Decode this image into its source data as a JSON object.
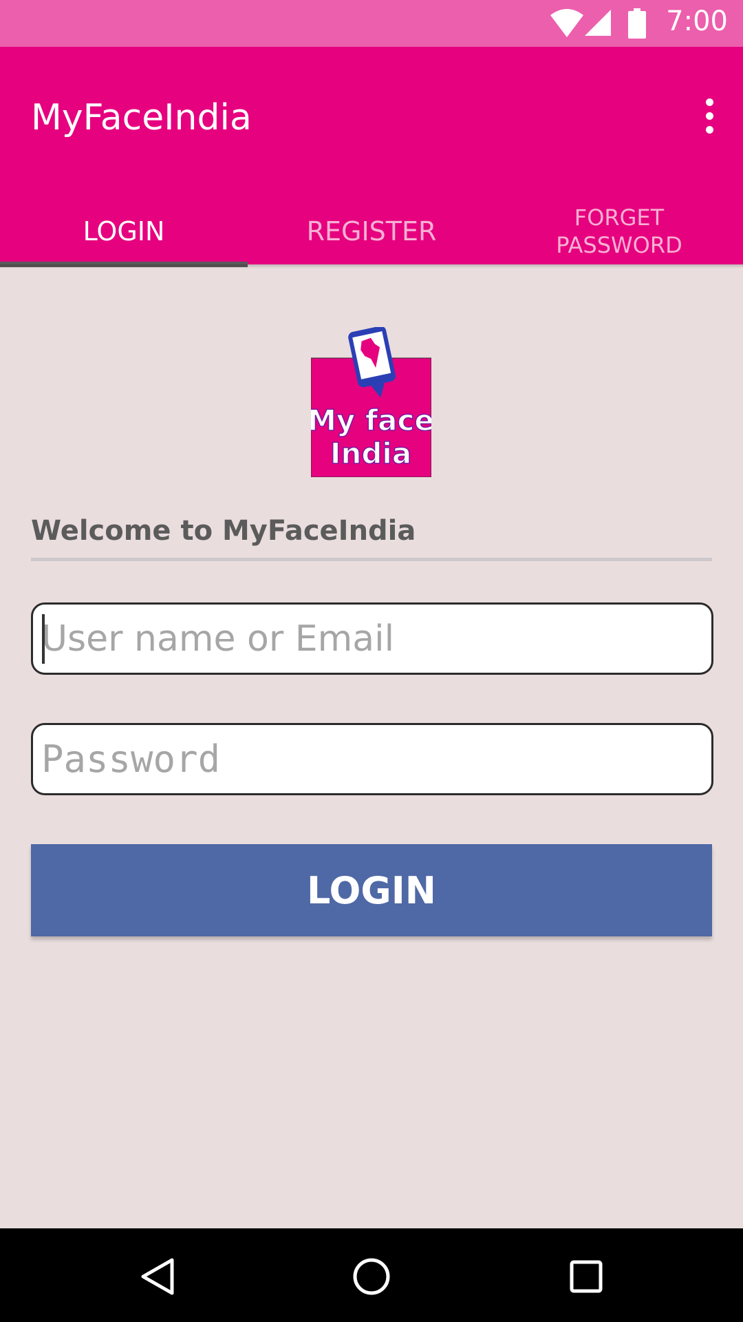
{
  "status_bar": {
    "time": "7:00",
    "icons": [
      "wifi-icon",
      "signal-icon",
      "battery-icon"
    ],
    "color": "#ec5fad"
  },
  "app_bar": {
    "title": "MyFaceIndia",
    "menu_icon": "more-vert-icon",
    "color": "#e6017f"
  },
  "tabs": [
    {
      "label": "LOGIN",
      "active": true
    },
    {
      "label": "REGISTER",
      "active": false
    },
    {
      "label_line1": "FORGET",
      "label_line2": "PASSWORD",
      "active": false
    }
  ],
  "logo": {
    "line1": "My face",
    "line2": "India"
  },
  "form": {
    "welcome": "Welcome to MyFaceIndia",
    "username_placeholder": "User name or Email",
    "username_value": "",
    "password_placeholder": "Password",
    "password_value": "",
    "login_label": "LOGIN",
    "button_color": "#4f68a6"
  },
  "nav_bar": {
    "icons": [
      "back-icon",
      "home-icon",
      "recents-icon"
    ]
  }
}
